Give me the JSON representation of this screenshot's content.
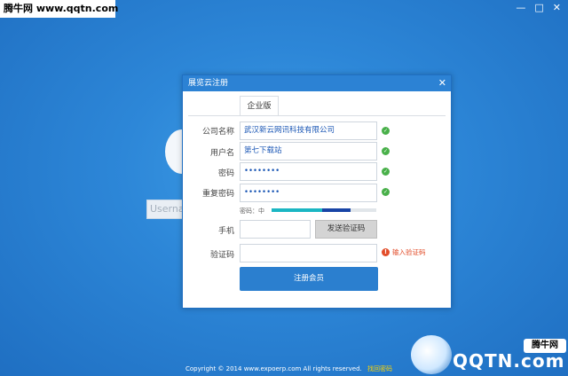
{
  "watermark": {
    "text": "腾牛网 www.qqtn.com"
  },
  "window_controls": {
    "minimize": "—",
    "maximize": "□",
    "close": "✕"
  },
  "background": {
    "username_placeholder": "Usernam"
  },
  "dialog": {
    "title": "展览云注册",
    "close_label": "✕",
    "tab_label": "企业版",
    "fields": {
      "company": {
        "label": "公司名称",
        "value": "武汉新云网讯科技有限公司"
      },
      "username": {
        "label": "用户名",
        "value": "第七下载站"
      },
      "password": {
        "label": "密码",
        "value": "••••••••"
      },
      "confirm_password": {
        "label": "重复密码",
        "value": "••••••••"
      },
      "phone": {
        "label": "手机",
        "value": ""
      },
      "verify_code": {
        "label": "验证码",
        "value": ""
      }
    },
    "strength": {
      "label": "密码：中",
      "level": 0.75
    },
    "sms_button_label": "发送验证码",
    "warning_text": "输入验证码",
    "register_button_label": "注册会员"
  },
  "footer": {
    "copyright": "Copyright © 2014 www.expoerp.com All rights reserved.",
    "link": "找回密码"
  },
  "logo": {
    "text": "QQTN.com",
    "badge": "腾牛网"
  },
  "colors": {
    "background": "#2d87d8",
    "titlebar": "#2c82d4",
    "button": "#2b7fcf",
    "success": "#49b04a",
    "warning": "#e24d2a"
  }
}
